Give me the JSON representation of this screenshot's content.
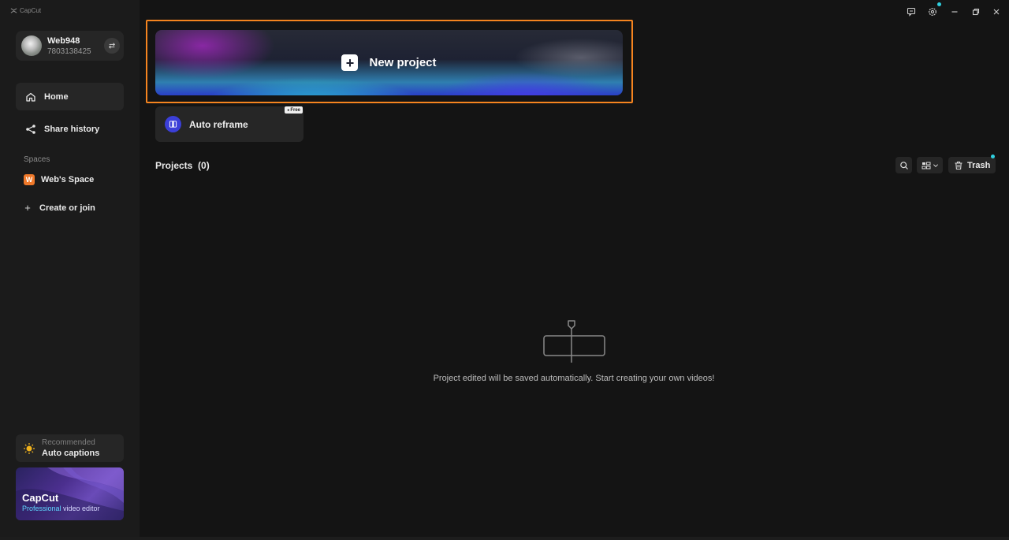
{
  "app": {
    "logo_text": "CapCut"
  },
  "profile": {
    "name": "Web948",
    "id": "7803138425"
  },
  "nav": {
    "home": "Home",
    "share_history": "Share history"
  },
  "spaces": {
    "label": "Spaces",
    "space_badge": "W",
    "space_name": "Web's Space",
    "create_join": "Create or join"
  },
  "recommended": {
    "label": "Recommended",
    "title": "Auto captions"
  },
  "promo": {
    "title": "CapCut",
    "sub_accent": "Professional",
    "sub_rest": " video editor"
  },
  "main": {
    "new_project": "New project",
    "auto_reframe": "Auto reframe",
    "free_badge": "Free",
    "projects_label": "Projects",
    "projects_count": "(0)",
    "trash": "Trash",
    "empty_message": "Project edited will be saved automatically. Start creating your own videos!"
  },
  "colors": {
    "accent_orange": "#f5841f",
    "notify_dot": "#2fd0e0",
    "space_badge": "#f0792a"
  },
  "icons": [
    "capcut-logo-icon",
    "swap-icon",
    "home-icon",
    "share-icon",
    "lightbulb-icon",
    "plus-icon",
    "reframe-icon",
    "search-icon",
    "grid-view-icon",
    "trash-icon",
    "feedback-icon",
    "settings-icon",
    "minimize-icon",
    "restore-icon",
    "close-icon"
  ]
}
